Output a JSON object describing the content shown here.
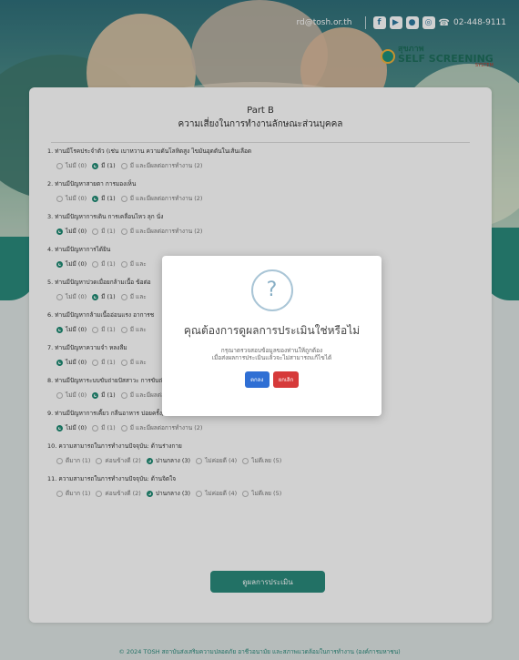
{
  "header": {
    "email": "rd@tosh.or.th",
    "phone": "02-448-9111",
    "logo_small": "สุขภาพ",
    "logo_big": "SELF SCREENING",
    "logo_sys": "SYSTEM"
  },
  "card": {
    "part": "Part B",
    "title": "ความเสี่ยงในการทำงานลักษณะส่วนบุคคล"
  },
  "questions": [
    {
      "text": "1.  ท่านมีโรคประจำตัว (เช่น เบาหวาน ความดันโลหิตสูง ไขมันอุดตันในเส้นเลือด",
      "options": [
        "ไม่มี (0)",
        "มี (1)",
        "มี และมีผลต่อการทำงาน (2)"
      ],
      "selected": 1
    },
    {
      "text": "2.  ท่านมีปัญหาสายตา การมองเห็น",
      "options": [
        "ไม่มี (0)",
        "มี (1)",
        "มี และมีผลต่อการทำงาน (2)"
      ],
      "selected": 1
    },
    {
      "text": "3.  ท่านมีปัญหาการเดิน การเคลื่อนไหว ลุก นั่ง",
      "options": [
        "ไม่มี (0)",
        "มี (1)",
        "มี และมีผลต่อการทำงาน (2)"
      ],
      "selected": 0
    },
    {
      "text": "4.  ท่านมีปัญหาการได้ยิน",
      "options": [
        "ไม่มี (0)",
        "มี (1)",
        "มี และ"
      ],
      "selected": 0
    },
    {
      "text": "5.  ท่านมีปัญหาปวดเมื่อยกล้ามเนื้อ ข้อต่อ",
      "options": [
        "ไม่มี (0)",
        "มี (1)",
        "มี และ"
      ],
      "selected": 1
    },
    {
      "text": "6.  ท่านมีปัญหากล้ามเนื้ออ่อนแรง อาการช",
      "options": [
        "ไม่มี (0)",
        "มี (1)",
        "มี และ"
      ],
      "selected": 0
    },
    {
      "text": "7.  ท่านมีปัญหาความจำ หลงลืม",
      "options": [
        "ไม่มี (0)",
        "มี (1)",
        "มี และ"
      ],
      "selected": 0
    },
    {
      "text": "8.  ท่านมีปัญหาระบบขับถ่ายปัสสาวะ การขับถ่ายบ่อยครั้ง/เป็นประจำ",
      "options": [
        "ไม่มี (0)",
        "มี (1)",
        "มี และมีผลต่อการทำงาน (2)"
      ],
      "selected": 1
    },
    {
      "text": "9.  ท่านมีปัญหาการเคี้ยว กลืนอาหาร บ่อยครั้ง/เป็นประจำ",
      "options": [
        "ไม่มี (0)",
        "มี (1)",
        "มี และมีผลต่อการทำงาน (2)"
      ],
      "selected": 0
    },
    {
      "text": "10.  ความสามารถในการทำงานปัจจุบัน: ด้านร่างกาย",
      "options": [
        "ดีมาก (1)",
        "ค่อนข้างดี (2)",
        "ปานกลาง (3)",
        "ไม่ค่อยดี (4)",
        "ไม่ดีเลย (5)"
      ],
      "selected": 2
    },
    {
      "text": "11.  ความสามารถในการทำงานปัจจุบัน: ด้านจิตใจ",
      "options": [
        "ดีมาก (1)",
        "ค่อนข้างดี (2)",
        "ปานกลาง (3)",
        "ไม่ค่อยดี (4)",
        "ไม่ดีเลย (5)"
      ],
      "selected": 2
    }
  ],
  "submit_label": "ดูผลการประเมิน",
  "footer": "© 2024 TOSH สถาบันส่งเสริมความปลอดภัย อาชีวอนามัย และสภาพแวดล้อมในการทำงาน (องค์การมหาชน)",
  "modal": {
    "icon": "?",
    "title": "คุณต้องการดูผลการประเมินใช่หรือไม่",
    "text_line1": "กรุณาตรวจสอบข้อมูลของท่านให้ถูกต้อง",
    "text_line2": "เมื่อส่งผลการประเมินแล้วจะไม่สามารถแก้ไขได้",
    "ok_label": "ตกลง",
    "cancel_label": "ยกเลิก"
  },
  "colors": {
    "accent": "#2a8a7c",
    "ok": "#2f6fd4",
    "cancel": "#d63a3a"
  }
}
